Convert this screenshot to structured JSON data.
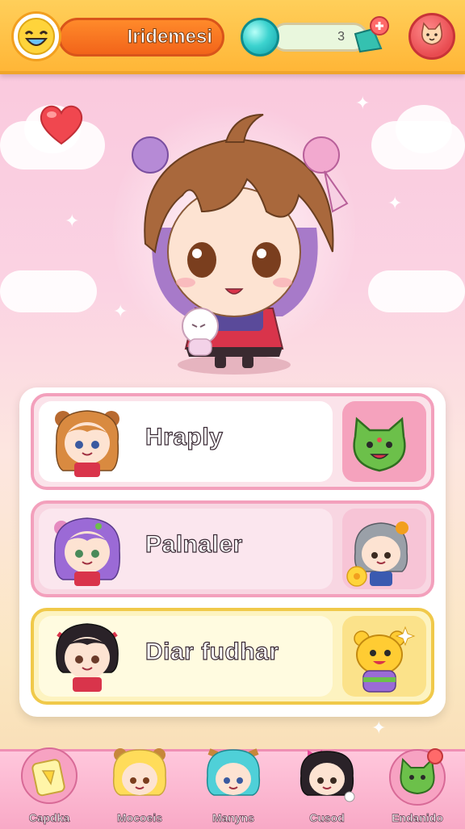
{
  "header": {
    "title": "Iridemesi",
    "gem_count": "3"
  },
  "menu": {
    "items": [
      {
        "label": "Hraply"
      },
      {
        "label": "Palnaler"
      },
      {
        "label": "Diar fudhar"
      }
    ]
  },
  "bottom_nav": {
    "items": [
      {
        "label": "Capdka",
        "icon": "card-icon"
      },
      {
        "label": "Mocoeis",
        "icon": "blonde-character-icon"
      },
      {
        "label": "Manyns",
        "icon": "teal-hair-character-icon"
      },
      {
        "label": "Cusod",
        "icon": "dark-hair-character-icon"
      },
      {
        "label": "Endanido",
        "icon": "green-cat-icon"
      }
    ]
  },
  "colors": {
    "topbar": "#ffb637",
    "title_pill": "#f2641a",
    "nav_bar": "#f8a9c6",
    "item_pink": "#f3a0bc",
    "item_yellow": "#f0c94a"
  }
}
